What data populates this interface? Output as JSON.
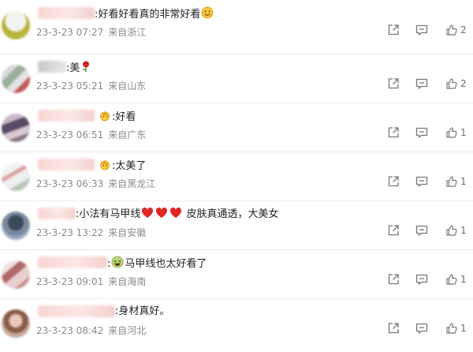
{
  "comments": [
    {
      "text_before": "",
      "text": "好看好看真的非常好看",
      "emoji_after": "smile-face",
      "time": "23-3-23 07:27",
      "location": "来自浙江",
      "likes": "2"
    },
    {
      "text_before": "",
      "text": "美",
      "emoji_after": "rose",
      "time": "23-3-23 05:21",
      "location": "来自山东",
      "likes": "2"
    },
    {
      "text_before": "",
      "text": "好看",
      "emoji_before": "crown-face",
      "time": "23-3-23 06:51",
      "location": "来自广东",
      "likes": "1"
    },
    {
      "text_before": "",
      "text": "太美了",
      "emoji_before": "crown-face",
      "time": "23-3-23 06:33",
      "location": "来自黑龙江",
      "likes": "1"
    },
    {
      "text_before": "小法有马甲线",
      "text": " 皮肤真通透，大美女",
      "emoji_between": [
        "red-heart",
        "red-heart",
        "red-heart"
      ],
      "time": "23-3-23 13:22",
      "location": "来自安徽",
      "likes": "1"
    },
    {
      "text_before": "",
      "text": "马甲线也太好看了",
      "emoji_before": "laughing-face",
      "time": "23-3-23 09:01",
      "location": "来自海南",
      "likes": "1"
    },
    {
      "text_before": "",
      "text": "身材真好。",
      "time": "23-3-23 08:42",
      "location": "来自河北",
      "likes": "1"
    }
  ],
  "colors": {
    "meta_text": "#8a8a8a",
    "icon": "#777777",
    "name_blur": "#f7d5d2"
  }
}
